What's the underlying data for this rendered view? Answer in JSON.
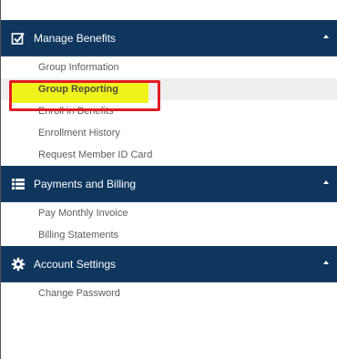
{
  "sections": [
    {
      "id": "manage-benefits",
      "title": "Manage Benefits",
      "icon": "checkbox-icon",
      "expanded": true,
      "items": [
        {
          "label": "Group Information"
        },
        {
          "label": "Group Reporting",
          "active": true
        },
        {
          "label": "Enroll in Benefits"
        },
        {
          "label": "Enrollment History"
        },
        {
          "label": "Request Member ID Card"
        }
      ]
    },
    {
      "id": "payments-billing",
      "title": "Payments and Billing",
      "icon": "list-icon",
      "expanded": true,
      "items": [
        {
          "label": "Pay Monthly Invoice"
        },
        {
          "label": "Billing Statements"
        }
      ]
    },
    {
      "id": "account-settings",
      "title": "Account Settings",
      "icon": "gear-icon",
      "expanded": true,
      "items": [
        {
          "label": "Change Password"
        }
      ]
    }
  ],
  "colors": {
    "header_bg": "#0f365d",
    "active_row_bg": "#eeeeee",
    "highlight_yellow": "#f0f21c",
    "highlight_red": "#e11b22",
    "item_text": "#5d5d5d"
  }
}
